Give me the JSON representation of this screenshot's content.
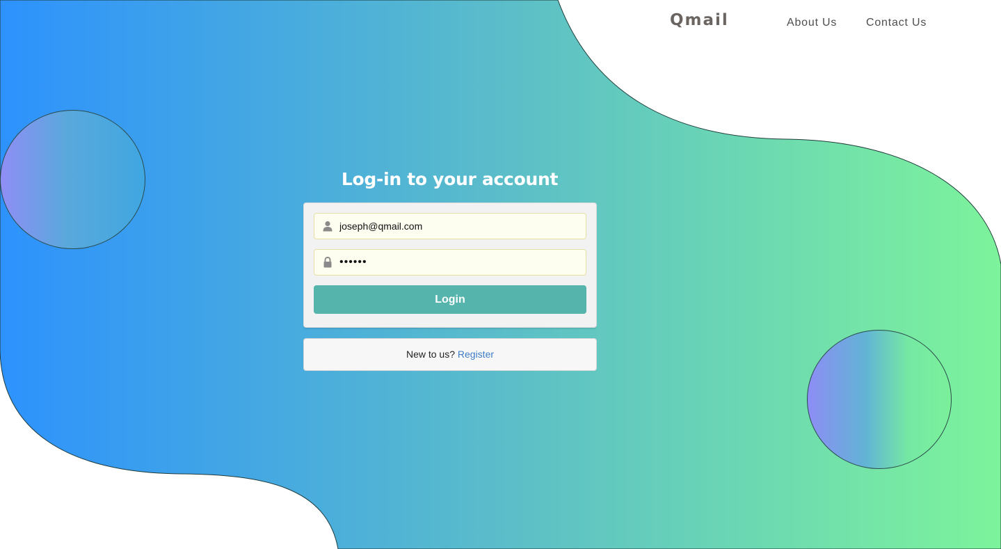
{
  "nav": {
    "brand": "Qmail",
    "links": [
      "About Us",
      "Contact Us"
    ]
  },
  "login": {
    "title": "Log-in to your account",
    "email_value": "joseph@qmail.com",
    "password_value": "......",
    "button_label": "Login"
  },
  "register": {
    "prompt": "New to us?",
    "link_label": "Register"
  },
  "colors": {
    "gradient_start": "#2d92fd",
    "gradient_end": "#7df39b",
    "button": "#55b5ad",
    "link": "#3d7bc6",
    "input_bg": "#fefef0"
  },
  "icons": {
    "email_field": "user-icon",
    "password_field": "lock-icon"
  }
}
